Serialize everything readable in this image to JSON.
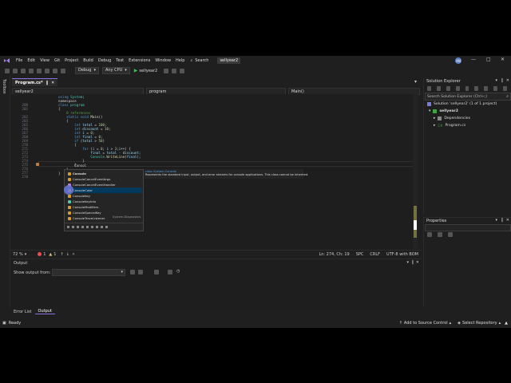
{
  "menubar": {
    "items": [
      "File",
      "Edit",
      "View",
      "Git",
      "Project",
      "Build",
      "Debug",
      "Test",
      "Extensions",
      "Window",
      "Help"
    ],
    "search_label": "Search",
    "solution_name": "sellyear2",
    "avatar_initials": "AN"
  },
  "toolbar": {
    "config": "Debug",
    "platform": "Any CPU",
    "start_target": "sellyear2"
  },
  "toolbox_label": "Toolbox",
  "tabs": [
    {
      "label": "Program.cs*"
    }
  ],
  "navbar": {
    "project": "sellyear2",
    "class": "program",
    "member": "Main()"
  },
  "code_lines": [
    {
      "num": "",
      "text": "using System;"
    },
    {
      "num": "",
      "text": "namespace"
    },
    {
      "num": "200",
      "text": "class program"
    },
    {
      "num": "201",
      "text": "{"
    },
    {
      "num": "",
      "text": "    0 references"
    },
    {
      "num": "202",
      "text": "    static void Main()"
    },
    {
      "num": "203",
      "text": "    {"
    },
    {
      "num": "265",
      "text": "        int total = 100;"
    },
    {
      "num": "266",
      "text": "        int discount = 10;"
    },
    {
      "num": "267",
      "text": "        int i = 0;"
    },
    {
      "num": "268",
      "text": "        int final = 0;"
    },
    {
      "num": "269",
      "text": "        if (total > 50)"
    },
    {
      "num": "270",
      "text": "        {"
    },
    {
      "num": "271",
      "text": "            for (i = 0; i > 3;i++) {"
    },
    {
      "num": "272",
      "text": "                final = total - discount;"
    },
    {
      "num": "273",
      "text": "                Console.WriteLine(final);"
    },
    {
      "num": "274",
      "text": "            }"
    },
    {
      "num": "275",
      "text": "        }"
    },
    {
      "num": "276",
      "text": "        Consol"
    },
    {
      "num": "277",
      "text": "    }"
    },
    {
      "num": "278",
      "text": "}"
    }
  ],
  "intellisense": {
    "items": [
      "Console",
      "ConsoleCancelEventArgs",
      "ConsoleCancelEventHandler",
      "ConsoleColor",
      "ConsoleKey",
      "ConsoleKeyInfo",
      "ConsoleModifiers",
      "ConsoleSpecialKey",
      "ConsoleTraceListener"
    ],
    "namespace_hint": "System.Diagnostics",
    "selected_index": 3
  },
  "tooltip": {
    "header": "class System.Console",
    "body": "Represents the standard input, output, and error streams for console applications. This class cannot be inherited."
  },
  "editor_status": {
    "zoom": "72 %",
    "errors": "1",
    "warnings": "1",
    "position": "Ln: 274, Ch: 19",
    "spc": "SPC",
    "eol": "CRLF",
    "encoding": "UTF-8 with BOM"
  },
  "output_panel": {
    "title": "Output",
    "show_from_label": "Show output from:"
  },
  "bottom_tabs": [
    "Error List",
    "Output"
  ],
  "solution_explorer": {
    "title": "Solution Explorer",
    "search_placeholder": "Search Solution Explorer (Ctrl+;)",
    "solution_label": "Solution 'sellyear2' (1 of 1 project)",
    "project": "sellyear2",
    "dependencies": "Dependencies",
    "file": "Program.cs"
  },
  "properties": {
    "title": "Properties"
  },
  "statusbar": {
    "ready": "Ready",
    "source_control": "Add to Source Control",
    "repository": "Select Repository"
  },
  "colors": {
    "accent": "#8a6ee0",
    "keyword": "#569cd6",
    "type": "#4ec9b0",
    "error": "#f14c4c"
  }
}
